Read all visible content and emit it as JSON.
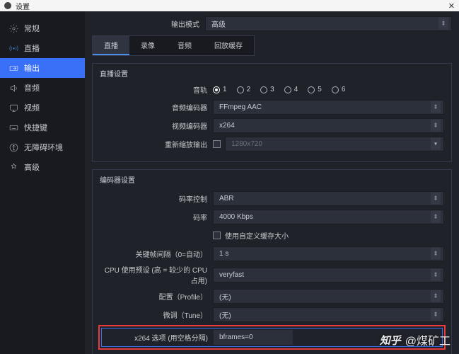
{
  "window_title": "设置",
  "output_mode_label": "输出模式",
  "output_mode_value": "高级",
  "tabs": [
    "直播",
    "录像",
    "音频",
    "回放缓存"
  ],
  "sidebar": {
    "items": [
      {
        "label": "常规"
      },
      {
        "label": "直播"
      },
      {
        "label": "输出"
      },
      {
        "label": "音频"
      },
      {
        "label": "视频"
      },
      {
        "label": "快捷键"
      },
      {
        "label": "无障碍环境"
      },
      {
        "label": "高级"
      }
    ]
  },
  "live_section_title": "直播设置",
  "tracks_label": "音轨",
  "tracks": [
    "1",
    "2",
    "3",
    "4",
    "5",
    "6"
  ],
  "audio_encoder_label": "音频编码器",
  "audio_encoder_value": "FFmpeg AAC",
  "video_encoder_label": "视频编码器",
  "video_encoder_value": "x264",
  "rescale_label": "重新缩放输出",
  "rescale_value": "1280x720",
  "encoder_section_title": "编码器设置",
  "rate_control_label": "码率控制",
  "rate_control_value": "ABR",
  "bitrate_label": "码率",
  "bitrate_value": "4000 Kbps",
  "custom_buffer_label": "使用自定义缓存大小",
  "keyint_label": "关键帧间隔（0=自动）",
  "keyint_value": "1 s",
  "cpu_preset_label": "CPU 使用预设 (高 = 较少的 CPU占用)",
  "cpu_preset_value": "veryfast",
  "profile_label": "配置（Profile）",
  "profile_value": "(无)",
  "tune_label": "微调（Tune）",
  "tune_value": "(无)",
  "x264_opts_label": "x264 选项 (用空格分隔)",
  "x264_opts_value": "bframes=0",
  "watermark_brand": "知乎",
  "watermark_user": "@煤矿工"
}
